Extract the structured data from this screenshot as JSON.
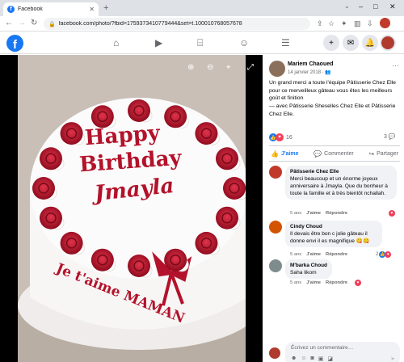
{
  "browser": {
    "tab_title": "Facebook",
    "new_tab": "+",
    "url": "facebook.com/photo/?fbid=1759373410779444&set=t.100010768057678",
    "min_btn": "–",
    "max_btn": "□",
    "close_btn": "✕"
  },
  "post": {
    "author": "Mariem Chaoued",
    "date": "14 janvier 2018 · ",
    "caption": "Un grand merci a toute l'équipe Pâtisserie Chez Elle pour ce merveilleux gâteau vous êtes les meilleurs goût et finition",
    "tag_prefix": "— avec ",
    "tag_page1": "Pâtisserie Sheselles Chez Elle",
    "tag_mid": " et ",
    "tag_page2": "Pâtisserie Chez Elle",
    "tag_end": ".",
    "reaction_count": "16",
    "comment_count": "3"
  },
  "actions": {
    "like": "J'aime",
    "comment": "Commenter",
    "share": "Partager"
  },
  "comments": [
    {
      "name": "Pâtisserie Chez Elle",
      "text": "Merci beaucoup et un énorme joyeux anniversaire à Jmayla. Que du bonheur à toute la famille et à très bientôt nchallah.",
      "age": "5 ans",
      "like": "J'aime",
      "reply": "Répondre",
      "reactions": ""
    },
    {
      "name": "Cindy Choud",
      "text": "Il devais être bon c jolie gâteau il donne envi il es magnifique 😋😋",
      "age": "5 ans",
      "like": "J'aime",
      "reply": "Répondre",
      "reactions": "2"
    },
    {
      "name": "M'barka Choud",
      "text": "Saha likom",
      "age": "5 ans",
      "like": "J'aime",
      "reply": "Répondre",
      "reactions": ""
    }
  ],
  "write_comment": {
    "placeholder": "Écrivez un commentaire…"
  },
  "cake": {
    "line1": "Happy",
    "line2": "Birthday",
    "line3": "Jmayla",
    "band": "Je t'aime MAMAN"
  },
  "colors": {
    "fb_blue": "#1877f2",
    "cake_red": "#b3122a"
  }
}
